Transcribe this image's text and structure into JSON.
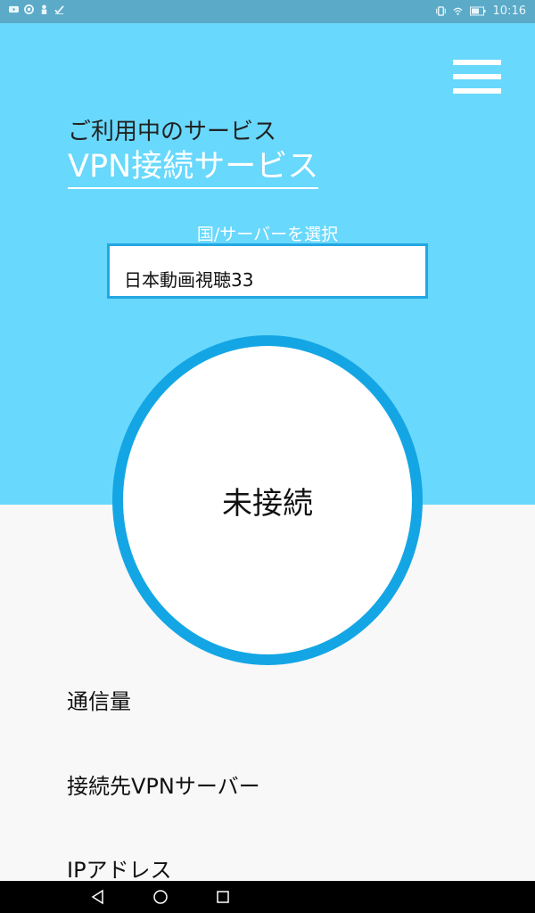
{
  "status_bar": {
    "time": "10:16",
    "left_icons": [
      "youtube-icon",
      "sync-icon",
      "person-icon",
      "checkmark-icon"
    ],
    "right_icons": [
      "vibrate-icon",
      "wifi-icon",
      "battery-icon"
    ]
  },
  "header": {
    "service_caption": "ご利用中のサービス",
    "service_name": "VPN接続サービス"
  },
  "server": {
    "label": "国/サーバーを選択",
    "selected": "日本動画視聴33"
  },
  "connection": {
    "status": "未接続"
  },
  "info": {
    "traffic_label": "通信量",
    "server_label": "接続先VPNサーバー",
    "ip_label": "IPアドレス"
  },
  "colors": {
    "hero_background": "#68d8fc",
    "accent": "#14a6e4",
    "page_background": "#f8f8f8"
  }
}
